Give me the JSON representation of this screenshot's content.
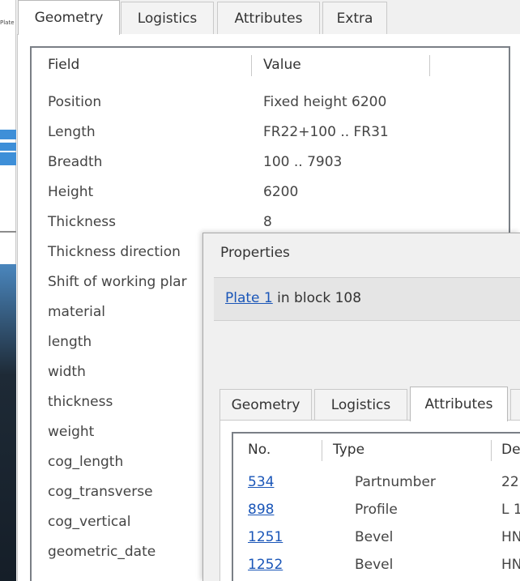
{
  "bg_strip": {
    "tiny_text": "Plate tus",
    "blue": "#3e8fd8",
    "dark": "#1e2a36"
  },
  "main": {
    "tabs": [
      {
        "label": "Geometry",
        "active": true
      },
      {
        "label": "Logistics",
        "active": false
      },
      {
        "label": "Attributes",
        "active": false
      },
      {
        "label": "Extra",
        "active": false
      }
    ],
    "grid": {
      "headers": {
        "field": "Field",
        "value": "Value"
      },
      "rows": [
        {
          "field": "Position",
          "value": "Fixed height 6200"
        },
        {
          "field": "Length",
          "value": "FR22+100 .. FR31"
        },
        {
          "field": "Breadth",
          "value": "100 .. 7903"
        },
        {
          "field": "Height",
          "value": "6200"
        },
        {
          "field": "Thickness",
          "value": "8"
        },
        {
          "field": "Thickness direction",
          "value": ""
        },
        {
          "field": "Shift of working plar",
          "value": ""
        },
        {
          "field": "material",
          "value": ""
        },
        {
          "field": "length",
          "value": ""
        },
        {
          "field": "width",
          "value": ""
        },
        {
          "field": "thickness",
          "value": ""
        },
        {
          "field": "weight",
          "value": ""
        },
        {
          "field": "cog_length",
          "value": ""
        },
        {
          "field": "cog_transverse",
          "value": ""
        },
        {
          "field": "cog_vertical",
          "value": ""
        },
        {
          "field": "geometric_date",
          "value": ""
        }
      ]
    }
  },
  "props": {
    "title": "Properties",
    "crumb": {
      "link": "Plate 1",
      "rest": " in block 108"
    },
    "tabs": [
      {
        "label": "Geometry",
        "active": false
      },
      {
        "label": "Logistics",
        "active": false
      },
      {
        "label": "Attributes",
        "active": true
      }
    ],
    "attr_grid": {
      "headers": {
        "no": "No.",
        "type": "Type",
        "desc": "De"
      },
      "rows": [
        {
          "no": "534",
          "type": "Partnumber",
          "desc": "22"
        },
        {
          "no": "898",
          "type": "Profile",
          "desc": "L 1"
        },
        {
          "no": "1251",
          "type": "Bevel",
          "desc": "HN"
        },
        {
          "no": "1252",
          "type": "Bevel",
          "desc": "HN"
        }
      ]
    },
    "link_color": "#1a56b8"
  }
}
